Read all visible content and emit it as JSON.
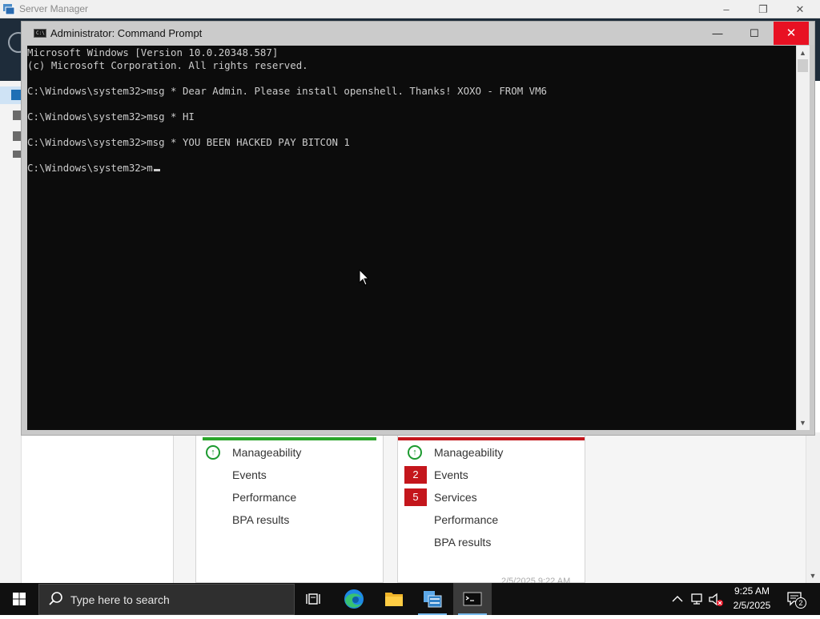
{
  "server_manager": {
    "title": "Server Manager",
    "controls": {
      "minimize": "–",
      "restore": "❐",
      "close": "✕"
    },
    "tile_left": {
      "rows": [
        "Manageability",
        "Events",
        "Performance",
        "BPA results"
      ]
    },
    "tile_right": {
      "rows": [
        {
          "label": "Manageability",
          "badge": ""
        },
        {
          "label": "Events",
          "badge": "2"
        },
        {
          "label": "Services",
          "badge": "5"
        },
        {
          "label": "Performance",
          "badge": ""
        },
        {
          "label": "BPA results",
          "badge": ""
        }
      ],
      "timestamp": "2/5/2025 9:22 AM"
    },
    "colors": {
      "ok": "#1c9a2f",
      "error": "#c4161c",
      "nav": "#1e2c3a"
    }
  },
  "cmd": {
    "title": "Administrator: Command Prompt",
    "icon_text": "C:\\",
    "controls": {
      "minimize": "—",
      "maximize": "☐",
      "close": "✕"
    },
    "lines": [
      "Microsoft Windows [Version 10.0.20348.587]",
      "(c) Microsoft Corporation. All rights reserved.",
      "",
      "C:\\Windows\\system32>msg * Dear Admin. Please install openshell. Thanks! XOXO - FROM VM6",
      "",
      "C:\\Windows\\system32>msg * HI",
      "",
      "C:\\Windows\\system32>msg * YOU BEEN HACKED PAY BITCON 1",
      ""
    ],
    "prompt": "C:\\Windows\\system32>m",
    "colors": {
      "background": "#0c0c0c",
      "text": "#cccccc",
      "close": "#e81123"
    }
  },
  "taskbar": {
    "search_placeholder": "Type here to search",
    "apps": [
      "task-view",
      "edge",
      "file-explorer",
      "server-manager",
      "command-prompt"
    ],
    "active_app": "command-prompt",
    "tray": {
      "time": "9:25 AM",
      "date": "2/5/2025",
      "notification_count": "2"
    },
    "colors": {
      "background": "#101010",
      "accent": "#76b9ed"
    }
  }
}
